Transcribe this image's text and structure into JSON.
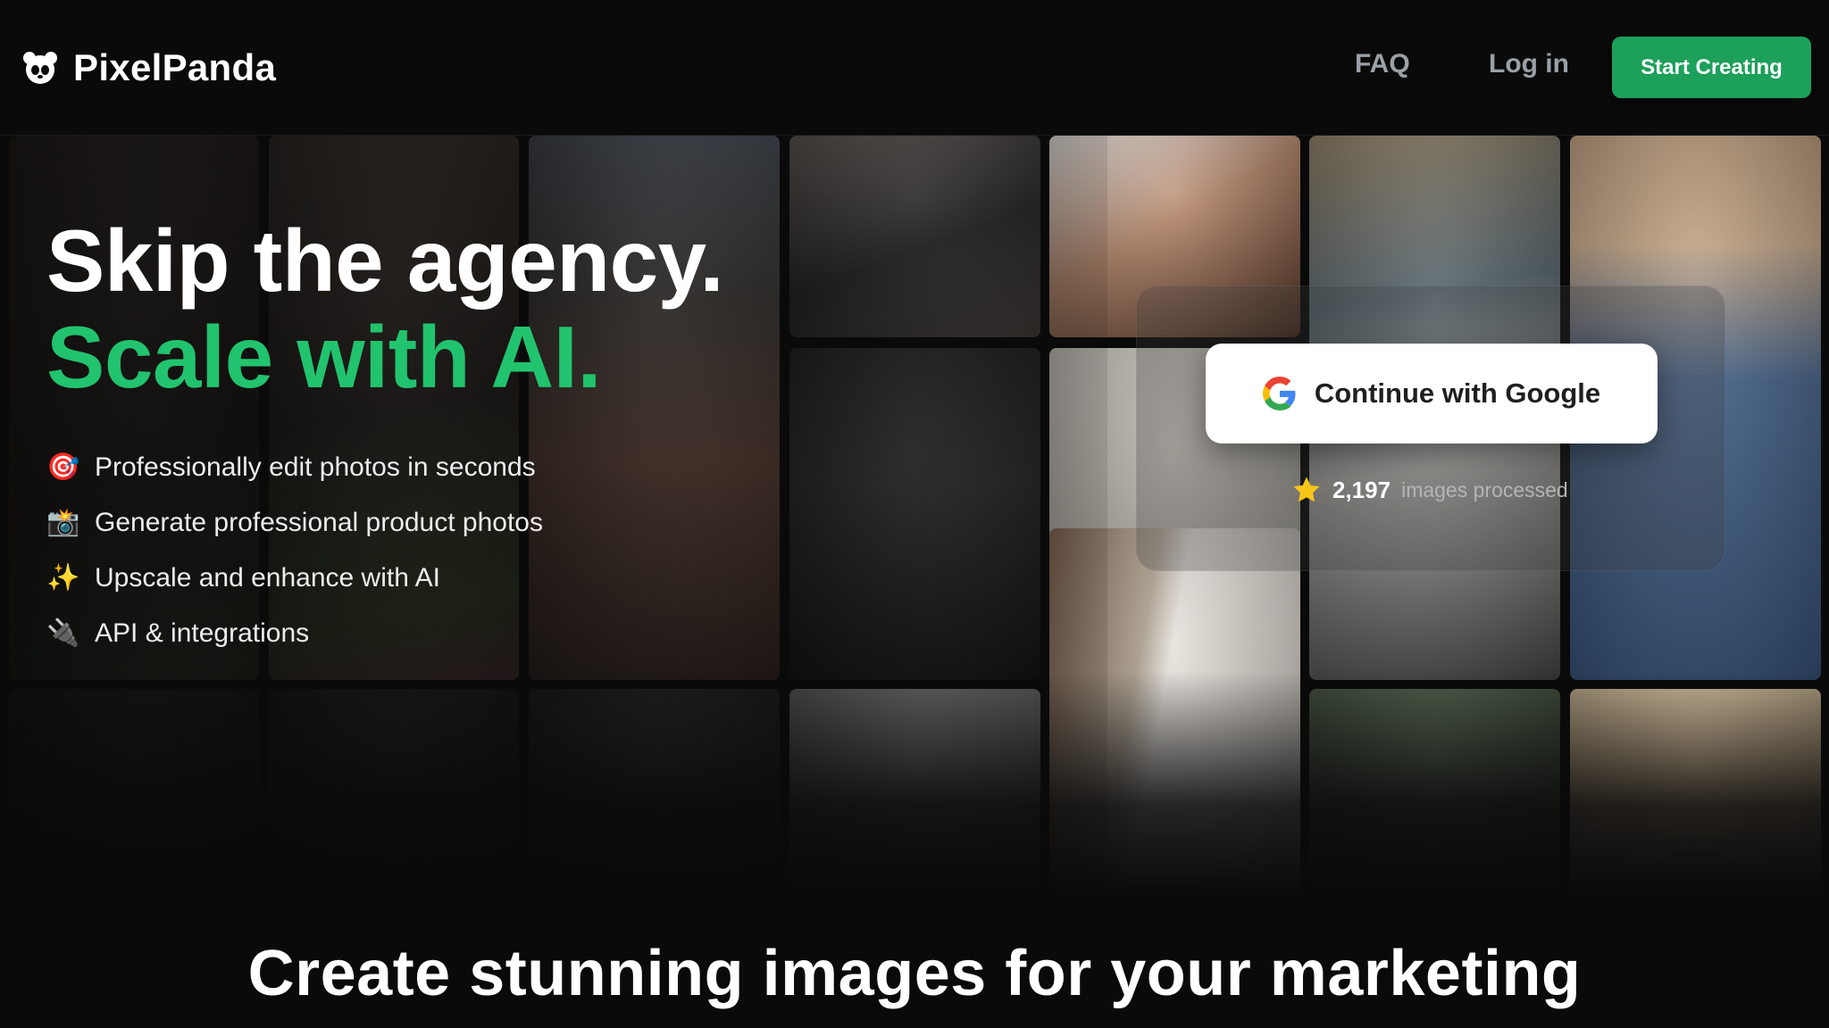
{
  "nav": {
    "brand": "PixelPanda",
    "faq": "FAQ",
    "login": "Log in",
    "cta": "Start Creating"
  },
  "hero": {
    "title_line1": "Skip the agency.",
    "title_line2": "Scale with AI.",
    "features": [
      {
        "icon": "target-icon",
        "emoji": "🎯",
        "label": "Professionally edit photos in seconds"
      },
      {
        "icon": "camera-icon",
        "emoji": "📸",
        "label": "Generate professional product photos"
      },
      {
        "icon": "sparkles-icon",
        "emoji": "✨",
        "label": "Upscale and enhance with AI"
      },
      {
        "icon": "plug-icon",
        "emoji": "🔌",
        "label": "API & integrations"
      }
    ]
  },
  "auth": {
    "google_label": "Continue with Google",
    "processed_count": "2,197",
    "processed_label": "images processed"
  },
  "section": {
    "heading": "Create stunning images for your marketing"
  },
  "colors": {
    "accent_green": "#22c36e",
    "cta_green": "#1ca05a",
    "background": "#0a0a0a"
  }
}
